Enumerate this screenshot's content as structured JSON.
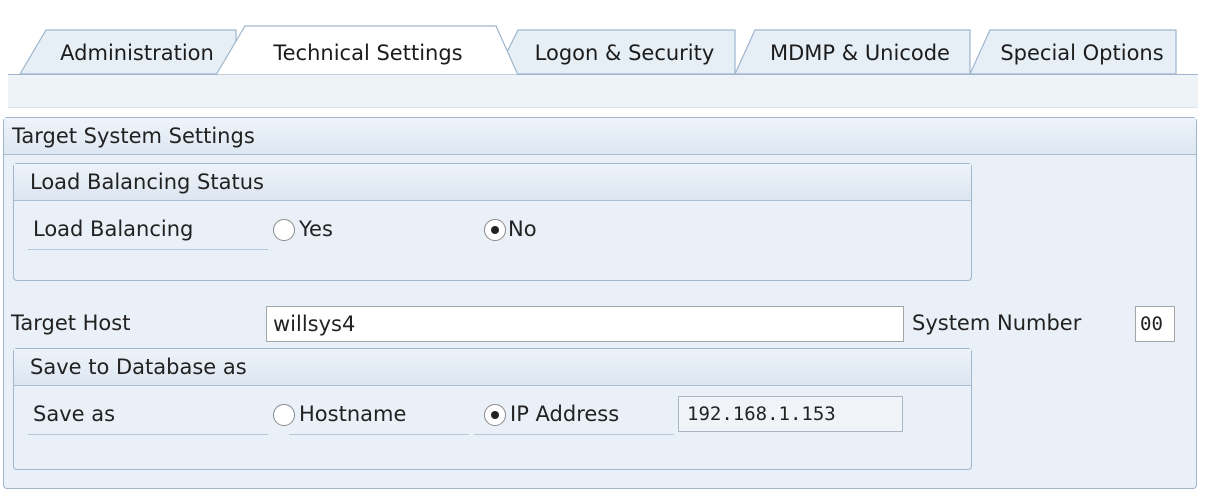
{
  "tabs": [
    {
      "label": "Administration",
      "active": false
    },
    {
      "label": "Technical Settings",
      "active": true
    },
    {
      "label": "Logon & Security",
      "active": false
    },
    {
      "label": "MDMP & Unicode",
      "active": false
    },
    {
      "label": "Special Options",
      "active": false
    }
  ],
  "target_system_settings": {
    "title": "Target System Settings",
    "load_balancing_status": {
      "title": "Load Balancing Status",
      "label": "Load Balancing",
      "options": [
        {
          "label": "Yes",
          "selected": false
        },
        {
          "label": "No",
          "selected": true
        }
      ]
    },
    "target_host": {
      "label": "Target Host",
      "value": "willsys4"
    },
    "system_number": {
      "label": "System Number",
      "value": "00"
    },
    "save_to_database": {
      "title": "Save to Database as",
      "label": "Save as",
      "options": [
        {
          "label": "Hostname",
          "selected": false
        },
        {
          "label": "IP Address",
          "selected": true
        }
      ],
      "ip_value": "192.168.1.153"
    }
  },
  "colors": {
    "panel_background": "#e9f0f7",
    "group_border": "#9fb6cd",
    "active_tab": "#ffffff",
    "inactive_tab": "#e6eef6"
  }
}
